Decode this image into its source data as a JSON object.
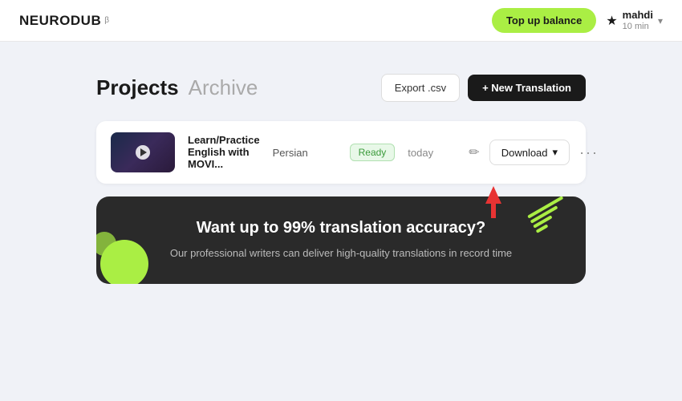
{
  "header": {
    "logo": "NEURODUB",
    "logo_beta": "β",
    "top_up_label": "Top up balance",
    "user": {
      "name": "mahdi",
      "credits": "10 min"
    }
  },
  "page": {
    "title": "Projects",
    "archive_label": "Archive",
    "export_label": "Export .csv",
    "new_translation_label": "+ New Translation"
  },
  "project": {
    "name": "Learn/Practice English with MOVI...",
    "language": "Persian",
    "status": "Ready",
    "date": "today",
    "download_label": "Download",
    "more_label": "···"
  },
  "promo": {
    "title": "Want up to 99% translation accuracy?",
    "subtitle": "Our professional writers can deliver high-quality translations in record time"
  }
}
